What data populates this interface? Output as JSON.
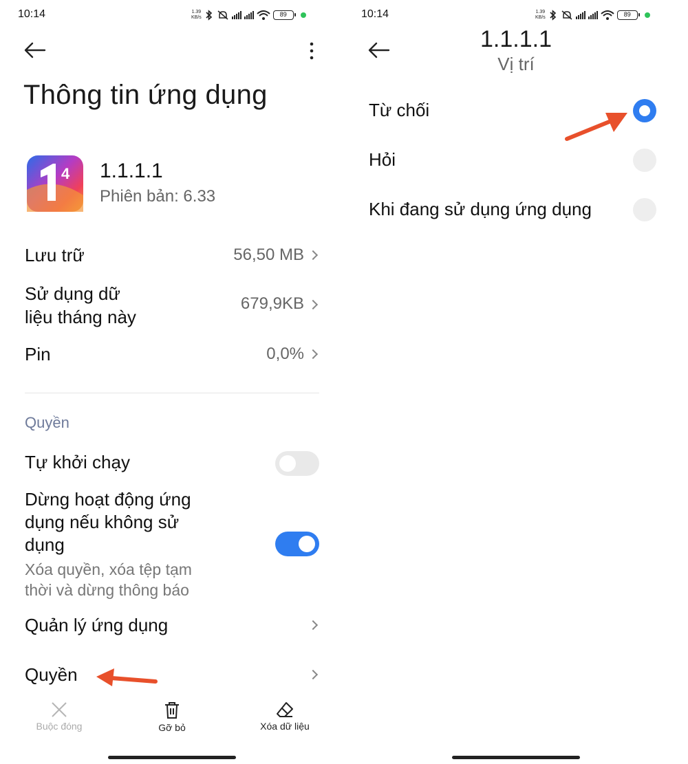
{
  "status_bar": {
    "time": "10:14",
    "speed_value": "1.39",
    "speed_unit": "KB/s",
    "battery": "89"
  },
  "left": {
    "page_title": "Thông tin ứng dụng",
    "app_name": "1.1.1.1",
    "app_version": "Phiên bản: 6.33",
    "rows": {
      "storage": {
        "label": "Lưu trữ",
        "value": "56,50 MB"
      },
      "data_usage": {
        "label_line1": "Sử dụng dữ",
        "label_line2": "liệu tháng này",
        "value": "679,9KB"
      },
      "battery": {
        "label": "Pin",
        "value": "0,0%"
      }
    },
    "permissions_section": "Quyền",
    "autostart": {
      "label": "Tự khởi chạy",
      "enabled": false
    },
    "pause_activity": {
      "label_line1": "Dừng hoạt động ứng",
      "label_line2": "dụng nếu không sử",
      "label_line3": "dụng",
      "desc_line1": "Xóa quyền, xóa tệp tạm",
      "desc_line2": "thời và dừng thông báo",
      "enabled": true
    },
    "manage_apps": "Quản lý ứng dụng",
    "permissions": "Quyền",
    "bottom_bar": {
      "force_stop": "Buộc đóng",
      "uninstall": "Gỡ bỏ",
      "clear_data": "Xóa dữ liệu"
    }
  },
  "right": {
    "title": "1.1.1.1",
    "subtitle": "Vị trí",
    "options": [
      {
        "label": "Từ chối",
        "selected": true
      },
      {
        "label": "Hỏi",
        "selected": false
      },
      {
        "label": "Khi đang sử dụng ứng dụng",
        "selected": false
      }
    ]
  },
  "colors": {
    "accent": "#2f7df0",
    "annotation_arrow": "#e8502b",
    "section_header": "#6e7a9a"
  }
}
